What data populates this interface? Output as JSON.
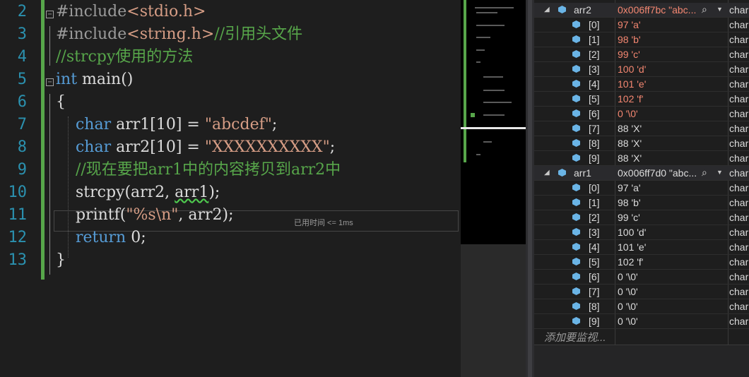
{
  "editor": {
    "lines": [
      {
        "num": "2",
        "segs": [
          {
            "t": "#include",
            "c": "pp"
          },
          {
            "t": "<stdio.h>",
            "c": "str"
          }
        ]
      },
      {
        "num": "3",
        "segs": [
          {
            "t": "#include",
            "c": "pp"
          },
          {
            "t": "<string.h>",
            "c": "str"
          },
          {
            "t": "//引用头文件",
            "c": "cm"
          }
        ]
      },
      {
        "num": "4",
        "segs": [
          {
            "t": "//strcpy使用的方法",
            "c": "cm"
          }
        ]
      },
      {
        "num": "5",
        "segs": [
          {
            "t": "int",
            "c": "kw"
          },
          {
            "t": " main()",
            "c": ""
          }
        ]
      },
      {
        "num": "6",
        "segs": [
          {
            "t": "{",
            "c": ""
          }
        ]
      },
      {
        "num": "7",
        "segs": [
          {
            "t": "    ",
            "c": ""
          },
          {
            "t": "char",
            "c": "kw"
          },
          {
            "t": " arr1[10] = ",
            "c": ""
          },
          {
            "t": "\"abcdef\"",
            "c": "str"
          },
          {
            "t": ";",
            "c": ""
          }
        ]
      },
      {
        "num": "8",
        "segs": [
          {
            "t": "    ",
            "c": ""
          },
          {
            "t": "char",
            "c": "kw"
          },
          {
            "t": " arr2[10] = ",
            "c": ""
          },
          {
            "t": "\"XXXXXXXXXX\"",
            "c": "str"
          },
          {
            "t": ";",
            "c": ""
          }
        ]
      },
      {
        "num": "9",
        "segs": [
          {
            "t": "    ",
            "c": ""
          },
          {
            "t": "//现在要把arr1中的内容拷贝到arr2中",
            "c": "cm"
          }
        ]
      },
      {
        "num": "10",
        "segs": [
          {
            "t": "    strcpy(arr2, ",
            "c": ""
          },
          {
            "t": "arr1",
            "c": "squiggle"
          },
          {
            "t": ");",
            "c": ""
          }
        ]
      },
      {
        "num": "11",
        "segs": [
          {
            "t": "    printf(",
            "c": ""
          },
          {
            "t": "\"%s\\n\"",
            "c": "str"
          },
          {
            "t": ", arr2);",
            "c": ""
          }
        ]
      },
      {
        "num": "12",
        "segs": [
          {
            "t": "    ",
            "c": ""
          },
          {
            "t": "return",
            "c": "kw"
          },
          {
            "t": " 0;",
            "c": ""
          }
        ]
      },
      {
        "num": "13",
        "segs": [
          {
            "t": "}",
            "c": ""
          }
        ]
      }
    ],
    "perf_tip": "已用时间 <= 1ms"
  },
  "watch": {
    "vars": [
      {
        "name": "arr2",
        "value": "0x006ff7bc \"abc...",
        "value_color": "red",
        "type": "char",
        "items": [
          {
            "idx": "[0]",
            "val": "97 'a'",
            "changed": true
          },
          {
            "idx": "[1]",
            "val": "98 'b'",
            "changed": true
          },
          {
            "idx": "[2]",
            "val": "99 'c'",
            "changed": true
          },
          {
            "idx": "[3]",
            "val": "100 'd'",
            "changed": true
          },
          {
            "idx": "[4]",
            "val": "101 'e'",
            "changed": true
          },
          {
            "idx": "[5]",
            "val": "102 'f'",
            "changed": true
          },
          {
            "idx": "[6]",
            "val": "0 '\\0'",
            "changed": true
          },
          {
            "idx": "[7]",
            "val": "88 'X'",
            "changed": false
          },
          {
            "idx": "[8]",
            "val": "88 'X'",
            "changed": false
          },
          {
            "idx": "[9]",
            "val": "88 'X'",
            "changed": false
          }
        ]
      },
      {
        "name": "arr1",
        "value": "0x006ff7d0 \"abc...",
        "value_color": "normal",
        "type": "char",
        "items": [
          {
            "idx": "[0]",
            "val": "97 'a'",
            "changed": false
          },
          {
            "idx": "[1]",
            "val": "98 'b'",
            "changed": false
          },
          {
            "idx": "[2]",
            "val": "99 'c'",
            "changed": false
          },
          {
            "idx": "[3]",
            "val": "100 'd'",
            "changed": false
          },
          {
            "idx": "[4]",
            "val": "101 'e'",
            "changed": false
          },
          {
            "idx": "[5]",
            "val": "102 'f'",
            "changed": false
          },
          {
            "idx": "[6]",
            "val": "0 '\\0'",
            "changed": false
          },
          {
            "idx": "[7]",
            "val": "0 '\\0'",
            "changed": false
          },
          {
            "idx": "[8]",
            "val": "0 '\\0'",
            "changed": false
          },
          {
            "idx": "[9]",
            "val": "0 '\\0'",
            "changed": false
          }
        ]
      }
    ],
    "add_watch_placeholder": "添加要监视..."
  },
  "colors": {
    "keyword": "#569cd6",
    "string": "#d69d85",
    "comment": "#57a64a",
    "changed_value": "#f48771",
    "line_number": "#2b91af"
  },
  "icons": [
    "expand-triangle-icon",
    "variable-cube-icon",
    "magnifier-icon",
    "dropdown-arrow-icon",
    "fold-box-icon"
  ]
}
